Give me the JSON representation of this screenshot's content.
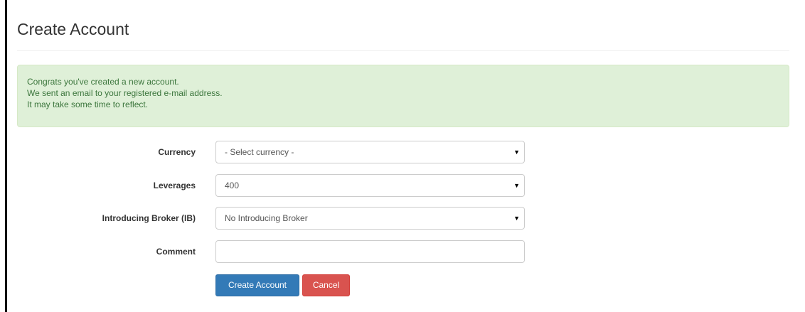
{
  "page": {
    "title": "Create Account"
  },
  "alert": {
    "lines": [
      "Congrats you've created a new account.",
      "We sent an email to your registered e-mail address.",
      "It may take some time to reflect."
    ]
  },
  "form": {
    "currency": {
      "label": "Currency",
      "selected": "- Select currency -"
    },
    "leverages": {
      "label": "Leverages",
      "selected": "400"
    },
    "introducing_broker": {
      "label": "Introducing Broker (IB)",
      "selected": "No Introducing Broker"
    },
    "comment": {
      "label": "Comment",
      "value": ""
    },
    "caret_glyph": "▼"
  },
  "buttons": {
    "create_label": "Create Account",
    "cancel_label": "Cancel"
  },
  "colors": {
    "alert_background": "#dff0d8",
    "alert_text": "#3c763d",
    "primary": "#337ab7",
    "danger": "#d9534f"
  },
  "icons": {
    "dropdown": "caret-down-icon"
  }
}
